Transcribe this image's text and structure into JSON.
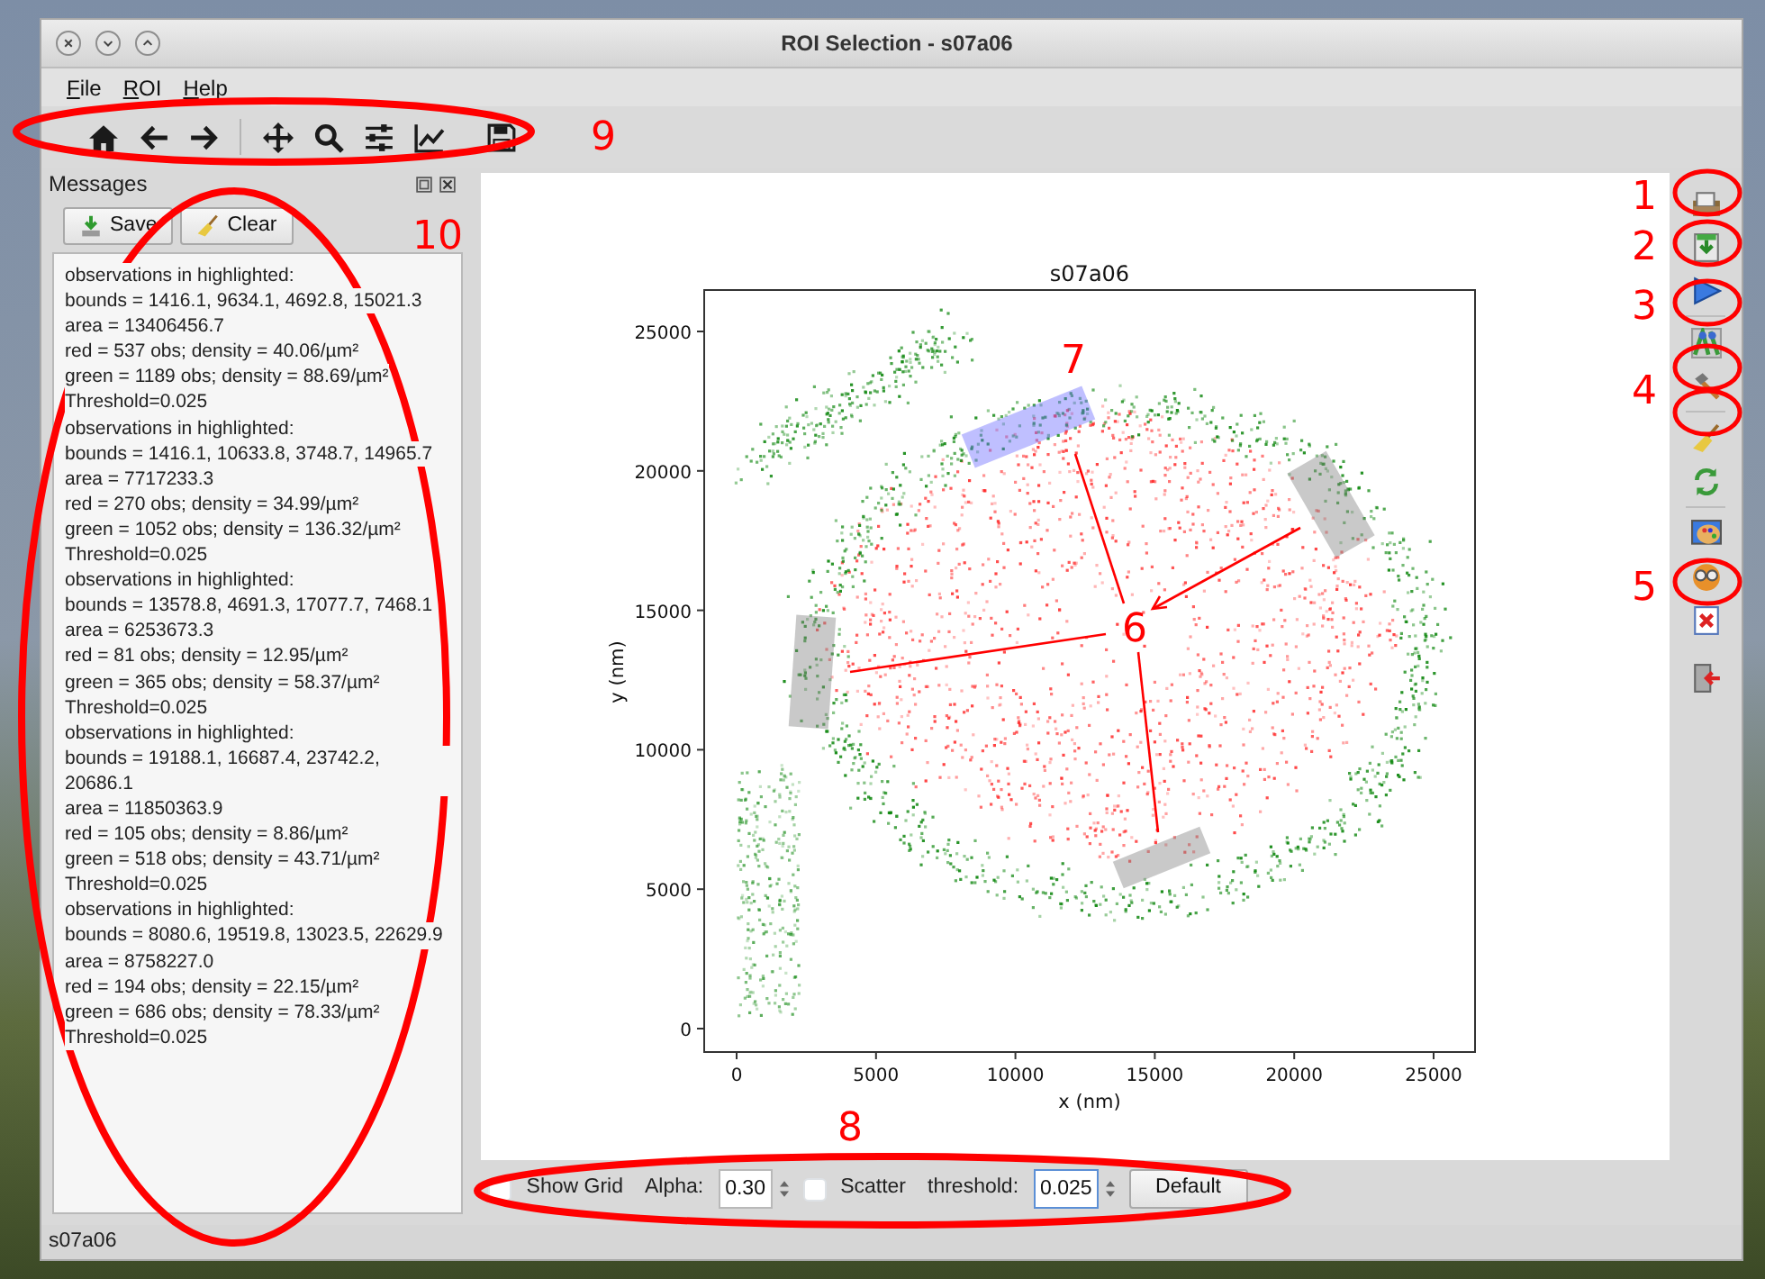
{
  "window": {
    "title": "ROI Selection - s07a06"
  },
  "menu": [
    "File",
    "ROI",
    "Help"
  ],
  "messages": {
    "title": "Messages",
    "buttons": [
      "Save",
      "Clear"
    ],
    "lines": [
      "observations in highlighted:",
      "bounds = 1416.1, 9634.1, 4692.8, 15021.3",
      "area = 13406456.7",
      "red = 537 obs; density = 40.06/µm²",
      "green = 1189 obs; density = 88.69/µm²",
      "Threshold=0.025",
      "observations in highlighted:",
      "bounds = 1416.1, 10633.8, 3748.7, 14965.7",
      "area = 7717233.3",
      "red = 270 obs; density = 34.99/µm²",
      "green = 1052 obs; density = 136.32/µm²",
      "Threshold=0.025",
      "observations in highlighted:",
      "bounds = 13578.8, 4691.3, 17077.7, 7468.1",
      "area = 6253673.3",
      "red = 81 obs; density = 12.95/µm²",
      "green = 365 obs; density = 58.37/µm²",
      "Threshold=0.025",
      "observations in highlighted:",
      "bounds = 19188.1, 16687.4, 23742.2, 20686.1",
      "area = 11850363.9",
      "red = 105 obs; density = 8.86/µm²",
      "green = 518 obs; density = 43.71/µm²",
      "Threshold=0.025",
      "observations in highlighted:",
      "bounds = 8080.6, 19519.8, 13023.5, 22629.9",
      "area = 8758227.0",
      "red = 194 obs; density = 22.15/µm²",
      "green = 686 obs; density = 78.33/µm²",
      "Threshold=0.025"
    ]
  },
  "plot": {
    "title": "s07a06",
    "xlabel": "x (nm)",
    "ylabel": "y (nm)",
    "xticks": [
      "0",
      "5000",
      "10000",
      "15000",
      "20000",
      "25000"
    ],
    "yticks": [
      "25000",
      "20000",
      "15000",
      "10000",
      "5000",
      "0"
    ],
    "regions": [
      {
        "selected": false
      },
      {
        "selected": true
      },
      {
        "selected": false
      },
      {
        "selected": false
      }
    ]
  },
  "controls": {
    "show_grid": {
      "label": "Show Grid",
      "checked": false
    },
    "alpha": {
      "label": "Alpha:",
      "value": "0.30"
    },
    "scatter": {
      "label": "Scatter",
      "checked": false
    },
    "threshold": {
      "label": "threshold:",
      "value": "0.025"
    },
    "default_button": "Default"
  },
  "status_bar": "s07a06",
  "annotations": [
    {
      "label": "1"
    },
    {
      "label": "2"
    },
    {
      "label": "3"
    },
    {
      "label": "4"
    },
    {
      "label": "5"
    },
    {
      "label": "6"
    },
    {
      "label": "7"
    },
    {
      "label": "8"
    },
    {
      "label": "9"
    },
    {
      "label": "10"
    }
  ]
}
